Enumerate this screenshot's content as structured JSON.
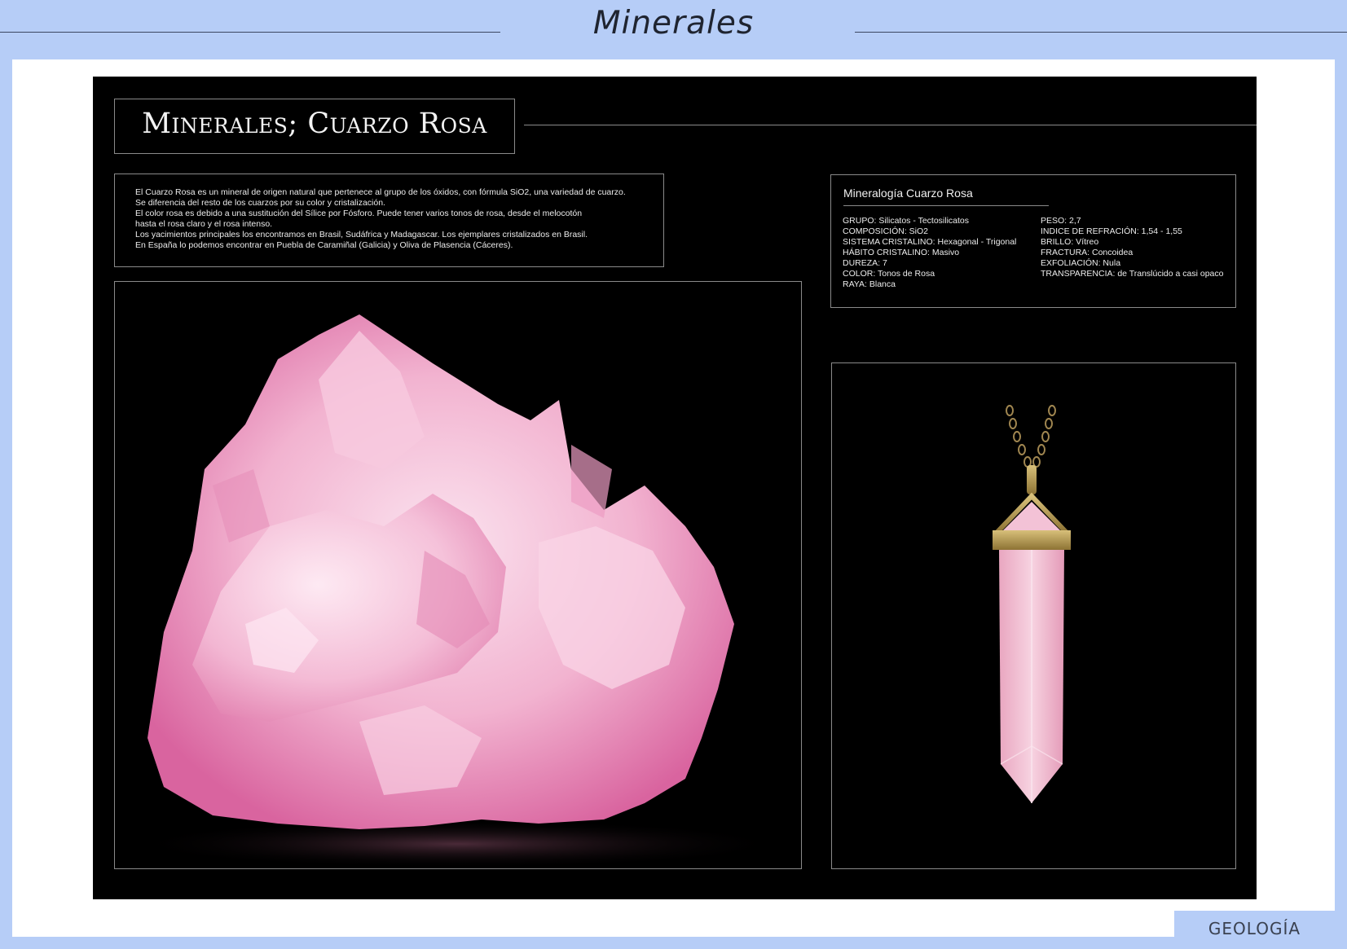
{
  "header": {
    "title": "Minerales"
  },
  "footer": {
    "label": "GEOLOGÍA"
  },
  "panel": {
    "title": "Minerales; Cuarzo Rosa",
    "description": [
      "El Cuarzo Rosa es un mineral de origen natural que pertenece al grupo de los óxidos, con fórmula SiO2, una variedad de cuarzo.",
      "Se diferencia del resto de los cuarzos por su color y cristalización.",
      "El color rosa es debido a una sustitución del Sílice por Fósforo. Puede tener varios tonos de rosa, desde el melocotón",
      "hasta el rosa claro y el rosa intenso.",
      "Los yacimientos principales los encontramos en Brasil, Sudáfrica y Madagascar. Los ejemplares cristalizados en Brasil.",
      "En España lo podemos encontrar en Puebla de Caramiñal (Galicia) y Oliva de Plasencia (Cáceres)."
    ],
    "mineralogy": {
      "title": "Mineralogía Cuarzo Rosa",
      "left": [
        "GRUPO: Silicatos - Tectosilicatos",
        "COMPOSICIÓN: SiO2",
        "SISTEMA CRISTALINO: Hexagonal - Trigonal",
        "HÁBITO CRISTALINO: Masivo",
        "DUREZA: 7",
        "COLOR: Tonos de Rosa",
        "RAYA: Blanca"
      ],
      "right": [
        "PESO: 2,7",
        "INDICE DE REFRACIÓN: 1,54 - 1,55",
        "BRILLO: Vítreo",
        "FRACTURA: Concoidea",
        "EXFOLIACIÓN: Nula",
        "TRANSPARENCIA: de Translúcido a casi opaco"
      ]
    }
  },
  "colors": {
    "background": "#b6cdf7",
    "panel": "#000000",
    "crystal": "#f1a9cc",
    "gold": "#b89a55"
  }
}
